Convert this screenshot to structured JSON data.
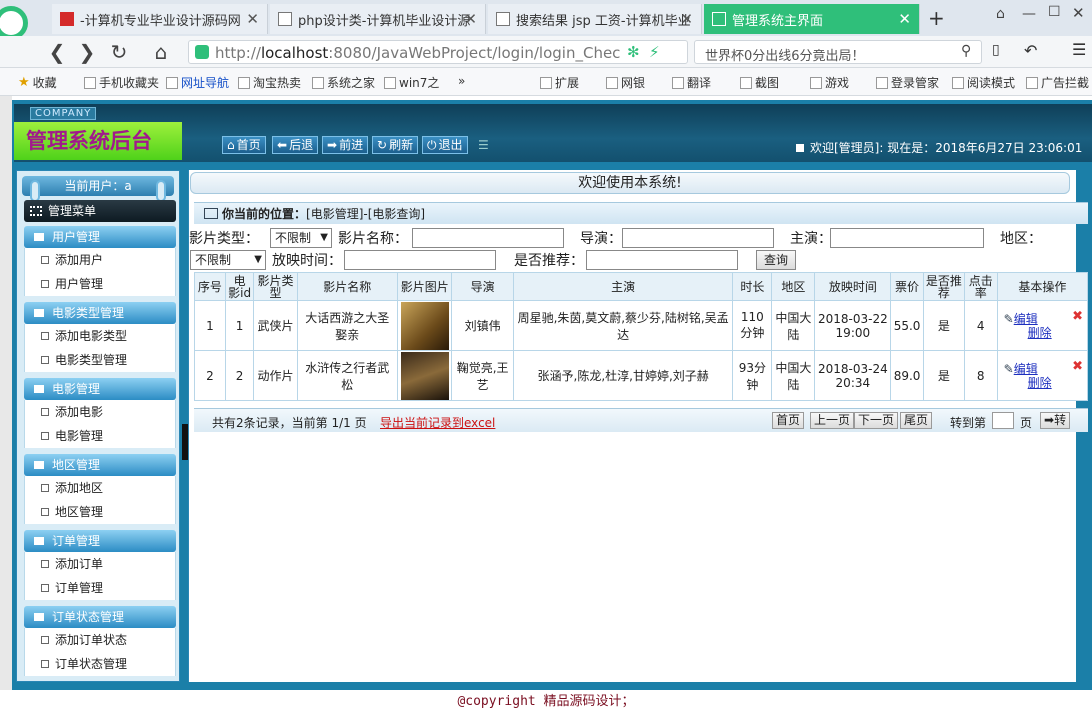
{
  "browser": {
    "tabs": [
      {
        "label": "-计算机专业毕业设计源码网",
        "active": false
      },
      {
        "label": "php设计类-计算机毕业设计源",
        "active": false
      },
      {
        "label": "搜索结果 jsp 工资-计算机毕业",
        "active": false
      },
      {
        "label": "管理系统主界面",
        "active": true
      }
    ],
    "new_tab": "+",
    "url_prefix": "http://",
    "url_host": "localhost",
    "url_rest": ":8080/JavaWebProject/login/login_Chec",
    "search_text": "世界杯0分出线6分竟出局！",
    "bookmarks": [
      "收藏",
      "手机收藏夹",
      "网址导航",
      "淘宝热卖",
      "系统之家",
      "win7之",
      "扩展",
      "网银",
      "翻译",
      "截图",
      "游戏",
      "登录管家",
      "阅读模式",
      "广告拦截"
    ]
  },
  "app": {
    "company": "COMPANY",
    "title": "管理系统后台",
    "toolbar": [
      "首页",
      "后退",
      "前进",
      "刷新",
      "退出"
    ],
    "welcome": "欢迎[管理员]:  现在是：2018年6月27日 23:06:01",
    "current_user": "当前用户：a",
    "menu_title": "管理菜单",
    "groups": [
      {
        "label": "用户管理",
        "items": [
          "添加用户",
          "用户管理"
        ]
      },
      {
        "label": "电影类型管理",
        "items": [
          "添加电影类型",
          "电影类型管理"
        ]
      },
      {
        "label": "电影管理",
        "items": [
          "添加电影",
          "电影管理"
        ]
      },
      {
        "label": "地区管理",
        "items": [
          "添加地区",
          "地区管理"
        ]
      },
      {
        "label": "订单管理",
        "items": [
          "添加订单",
          "订单管理"
        ]
      },
      {
        "label": "订单状态管理",
        "items": [
          "添加订单状态",
          "订单状态管理"
        ]
      }
    ],
    "welcome_banner": "欢迎使用本系统!",
    "location_label": "你当前的位置：",
    "location_path": "[电影管理]-[电影查询]"
  },
  "filters": {
    "type_label": "影片类型：",
    "type_value": "不限制",
    "name_label": "影片名称：",
    "director_label": "导演：",
    "actor_label": "主演：",
    "region_label": "地区：",
    "region_value": "不限制",
    "time_label": "放映时间：",
    "recommend_label": "是否推荐：",
    "query_button": "查询"
  },
  "table": {
    "headers": [
      "序号",
      "电影id",
      "影片类型",
      "影片名称",
      "影片图片",
      "导演",
      "主演",
      "时长",
      "地区",
      "放映时间",
      "票价",
      "是否推荐",
      "点击率",
      "基本操作"
    ],
    "rows": [
      {
        "no": "1",
        "id": "1",
        "type": "武侠片",
        "name": "大话西游之大圣娶亲",
        "director": "刘镇伟",
        "actors": "周星驰,朱茵,莫文蔚,蔡少芬,陆树铭,吴孟达",
        "duration": "110分钟",
        "region": "中国大陆",
        "time": "2018-03-22 19:00",
        "price": "55.0",
        "recommend": "是",
        "clicks": "4",
        "edit": "编辑",
        "delete": "删除"
      },
      {
        "no": "2",
        "id": "2",
        "type": "动作片",
        "name": "水浒传之行者武松",
        "director": "鞠觉亮,王艺",
        "actors": "张涵予,陈龙,杜淳,甘婷婷,刘子赫",
        "duration": "93分钟",
        "region": "中国大陆",
        "time": "2018-03-24 20:34",
        "price": "89.0",
        "recommend": "是",
        "clicks": "8",
        "edit": "编辑",
        "delete": "删除"
      }
    ]
  },
  "pager": {
    "info": "共有2条记录，当前第 1/1 页",
    "export": "导出当前记录到excel",
    "buttons": [
      "首页",
      "上一页",
      "下一页",
      "尾页"
    ],
    "goto_label": "转到第",
    "page_unit": "页",
    "go_button": "转"
  },
  "footer": "@copyright 精品源码设计；"
}
